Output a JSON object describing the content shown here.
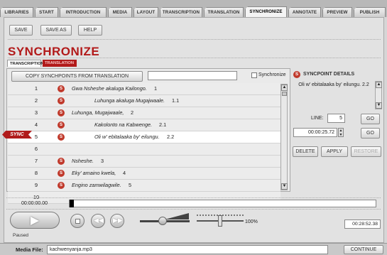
{
  "tabs": [
    "LIBRARIES",
    "START",
    "INTRODUCTION",
    "MEDIA",
    "LAYOUT",
    "TRANSCRIPTION",
    "TRANSLATION",
    "SYNCHRONIZE",
    "ANNOTATE",
    "PREVIEW",
    "PUBLISH"
  ],
  "active_tab": "SYNCHRONIZE",
  "toolbar": {
    "save": "SAVE",
    "save_as": "SAVE AS",
    "help": "HELP"
  },
  "page_title": "SYNCHRONIZE",
  "subtabs": {
    "transcription": "TRANSCRIPTION",
    "translation": "TRANSLATION"
  },
  "copy_button": "COPY SYNCHPOINTS FROM TRANSLATION",
  "copy_field_value": "",
  "synchronize_label": "Synchronize",
  "sync_badge": "SYNC",
  "rows": [
    {
      "num": "1",
      "mark": "S",
      "text": "Gwa Nsheshe akaluga Kailongo.",
      "seg": "1",
      "indent": 0
    },
    {
      "num": "2",
      "mark": "S",
      "text": "Luhunga akaluga Mugajwaale.",
      "seg": "1.1",
      "indent": 2
    },
    {
      "num": "3",
      "mark": "S",
      "text": "Luhunga, Mugajwaale,",
      "seg": "2",
      "indent": 0
    },
    {
      "num": "4",
      "mark": "S",
      "text": "Kakolonto na Kabwenge.",
      "seg": "2.1",
      "indent": 2
    },
    {
      "num": "5",
      "mark": "S",
      "text": "Oli w' ebitalaaka by' eilungu.",
      "seg": "2.2",
      "indent": 2
    },
    {
      "num": "6",
      "mark": "",
      "text": "",
      "seg": "",
      "indent": 0
    },
    {
      "num": "7",
      "mark": "S",
      "text": "Nsheshe.",
      "seg": "3",
      "indent": 0
    },
    {
      "num": "8",
      "mark": "S",
      "text": "Eky' amaino kwela,",
      "seg": "4",
      "indent": 0
    },
    {
      "num": "9",
      "mark": "S",
      "text": "Engino zamwilagwile.",
      "seg": "5",
      "indent": 0
    },
    {
      "num": "10",
      "mark": "",
      "text": "",
      "seg": "",
      "indent": 0
    }
  ],
  "selected_row": 4,
  "details": {
    "header": "SYNCPOINT DETAILS",
    "text": "Oli w' ebitalaaka by' eilungu. 2.2",
    "line_label": "LINE:",
    "line_value": "5",
    "go_label": "GO",
    "time_value": "00:00:25.72",
    "go2_label": "GO",
    "delete_label": "DELETE",
    "apply_label": "APPLY",
    "restore_label": "RESTORE"
  },
  "timeline": {
    "start": "00:00:00.00",
    "position_fraction": 0.0
  },
  "transport": {
    "status": "Paused",
    "zoom": "100%",
    "duration": "00:28:52.38",
    "volume_fraction": 0.45,
    "speed_fraction": 0.5
  },
  "media_file": {
    "label": "Media File:",
    "value": "kachwenyanja.mp3",
    "continue": "CONTINUE"
  },
  "colors": {
    "accent": "#b21a1a",
    "badge": "#c0392b"
  }
}
